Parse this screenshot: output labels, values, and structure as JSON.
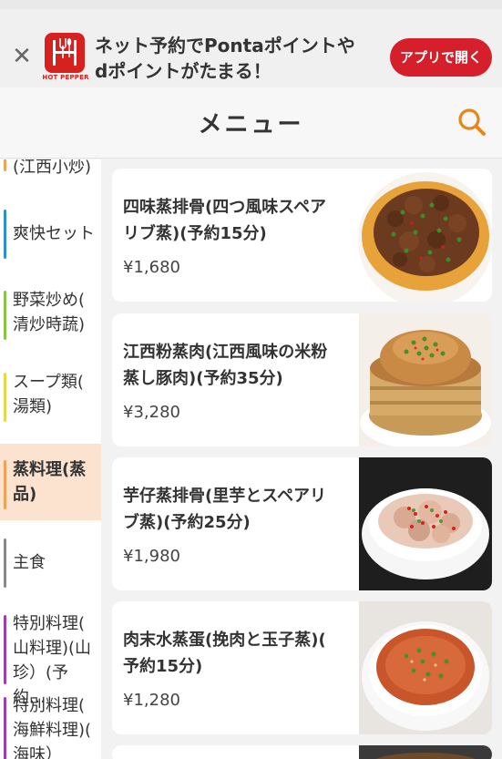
{
  "banner": {
    "close": "✕",
    "logo_text": "HOT PEPPER",
    "line1": "ネット予約でPontaポイントや",
    "line2": "dポイントがたまる！",
    "cta": "アプリで開く"
  },
  "header": {
    "title": "メニュー"
  },
  "sidebar": {
    "items": [
      {
        "line1": "(江西小炒)",
        "line2": "",
        "color": "#f0a356"
      },
      {
        "line1": "爽快セット",
        "line2": "",
        "color": "#2b8fd6"
      },
      {
        "line1": "野菜炒め(",
        "line2": "清炒時蔬)",
        "color": "#8bc34a"
      },
      {
        "line1": "スープ類(",
        "line2": "湯類)",
        "color": "#e5d84a"
      },
      {
        "line1": "蒸料理(蒸",
        "line2": "品)",
        "color": "#f0a356"
      },
      {
        "line1": "主食",
        "line2": "",
        "color": "#888888"
      },
      {
        "line1": "特別料理(",
        "line2": "山料理)(山",
        "line3": "珍）(予約…",
        "color": "#9b3fb5"
      },
      {
        "line1": "特別料理(",
        "line2": "海鮮料理)(",
        "line3": "海味）(予…",
        "color": "#9b3fb5"
      }
    ]
  },
  "menu_items": [
    {
      "name1": "四味蒸排骨(四つ風味スペア",
      "name2": "リブ蒸)(予約15分)",
      "price": "¥1,680"
    },
    {
      "name1": "江西粉蒸肉(江西風味の米粉",
      "name2": "蒸し豚肉)(予約35分)",
      "price": "¥3,280"
    },
    {
      "name1": "芋仔蒸排骨(里芋とスペアリ",
      "name2": "ブ蒸)(予約25分)",
      "price": "¥1,980"
    },
    {
      "name1": "肉末水蒸蛋(挽肉と玉子蒸)(",
      "name2": "予約15分)",
      "price": "¥1,280"
    }
  ]
}
